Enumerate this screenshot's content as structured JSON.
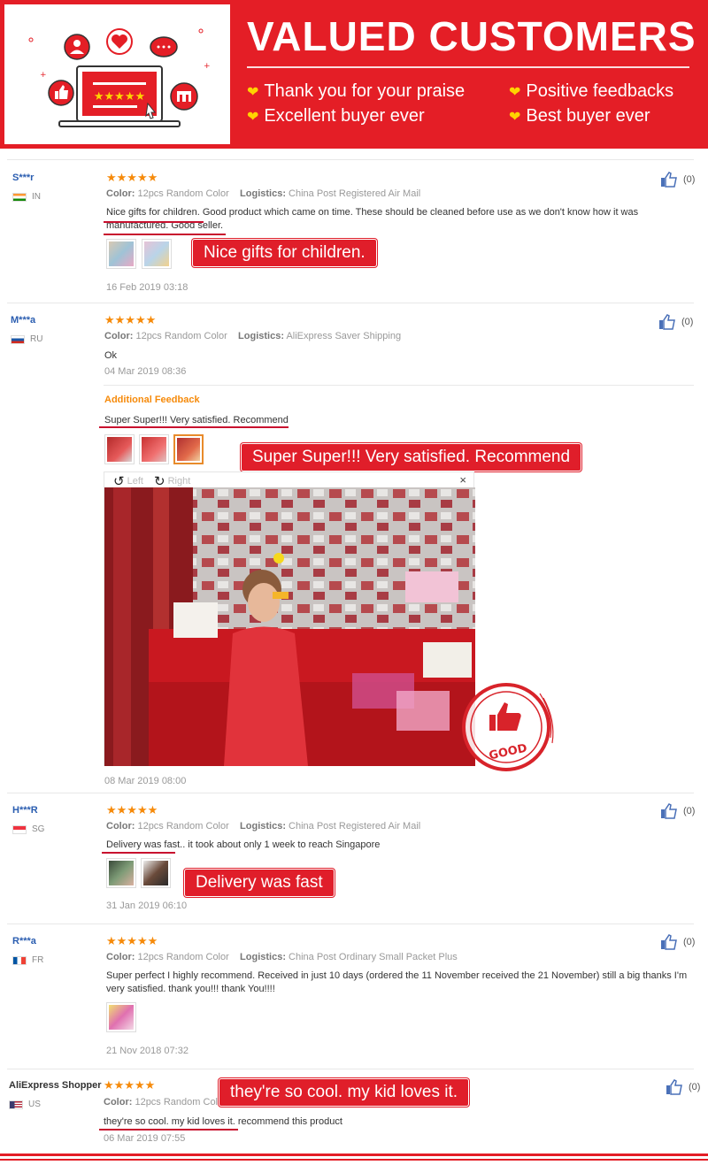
{
  "banner": {
    "title": "VALUED CUSTOMERS",
    "praises": [
      "Thank you for your praise",
      "Positive feedbacks",
      "Excellent buyer ever",
      "Best buyer ever"
    ],
    "accent": "#e41e26"
  },
  "labels": {
    "color": "Color:",
    "logistics": "Logistics:",
    "additional_feedback": "Additional Feedback",
    "left": "Left",
    "right": "Right",
    "close": "×"
  },
  "reviews": [
    {
      "user": "S***r",
      "country": "IN",
      "stars": "★★★★★",
      "color": "12pcs Random Color",
      "logistics": "China Post Registered Air Mail",
      "text": "Nice gifts for children. Good product which came on time. These should be cleaned before use as we don't know how it was manufactured. Good seller.",
      "date": "16 Feb 2019 03:18",
      "likes": "(0)",
      "callout": "Nice gifts for children."
    },
    {
      "user": "M***a",
      "country": "RU",
      "stars": "★★★★★",
      "color": "12pcs Random Color",
      "logistics": "AliExpress Saver Shipping",
      "text": "Ok",
      "date": "04 Mar 2019 08:36",
      "likes": "(0)",
      "additional_text": "Super Super!!! Very satisfied. Recommend",
      "additional_date": "08 Mar 2019 08:00",
      "callout": "Super Super!!! Very satisfied. Recommend",
      "stamp_text": "GOOD"
    },
    {
      "user": "H***R",
      "country": "SG",
      "stars": "★★★★★",
      "color": "12pcs Random Color",
      "logistics": "China Post Registered Air Mail",
      "text": "Delivery was fast.. it took about only 1 week to reach Singapore",
      "date": "31 Jan 2019 06:10",
      "likes": "(0)",
      "callout": "Delivery was fast"
    },
    {
      "user": "R***a",
      "country": "FR",
      "stars": "★★★★★",
      "color": "12pcs Random Color",
      "logistics": "China Post Ordinary Small Packet Plus",
      "text": "Super perfect I highly recommend. Received in just 10 days (ordered the 11 November received the 21 November) still a big thanks I'm very satisfied. thank you!!! thank You!!!!",
      "date": "21 Nov 2018 07:32",
      "likes": "(0)"
    },
    {
      "user": "AliExpress Shopper",
      "country": "US",
      "stars": "★★★★★",
      "color": "12pcs Random Color",
      "text": "they're so cool. my kid loves it. recommend this product",
      "date": "06 Mar 2019 07:55",
      "likes": "(0)",
      "callout": "they're so cool. my kid loves it."
    }
  ]
}
